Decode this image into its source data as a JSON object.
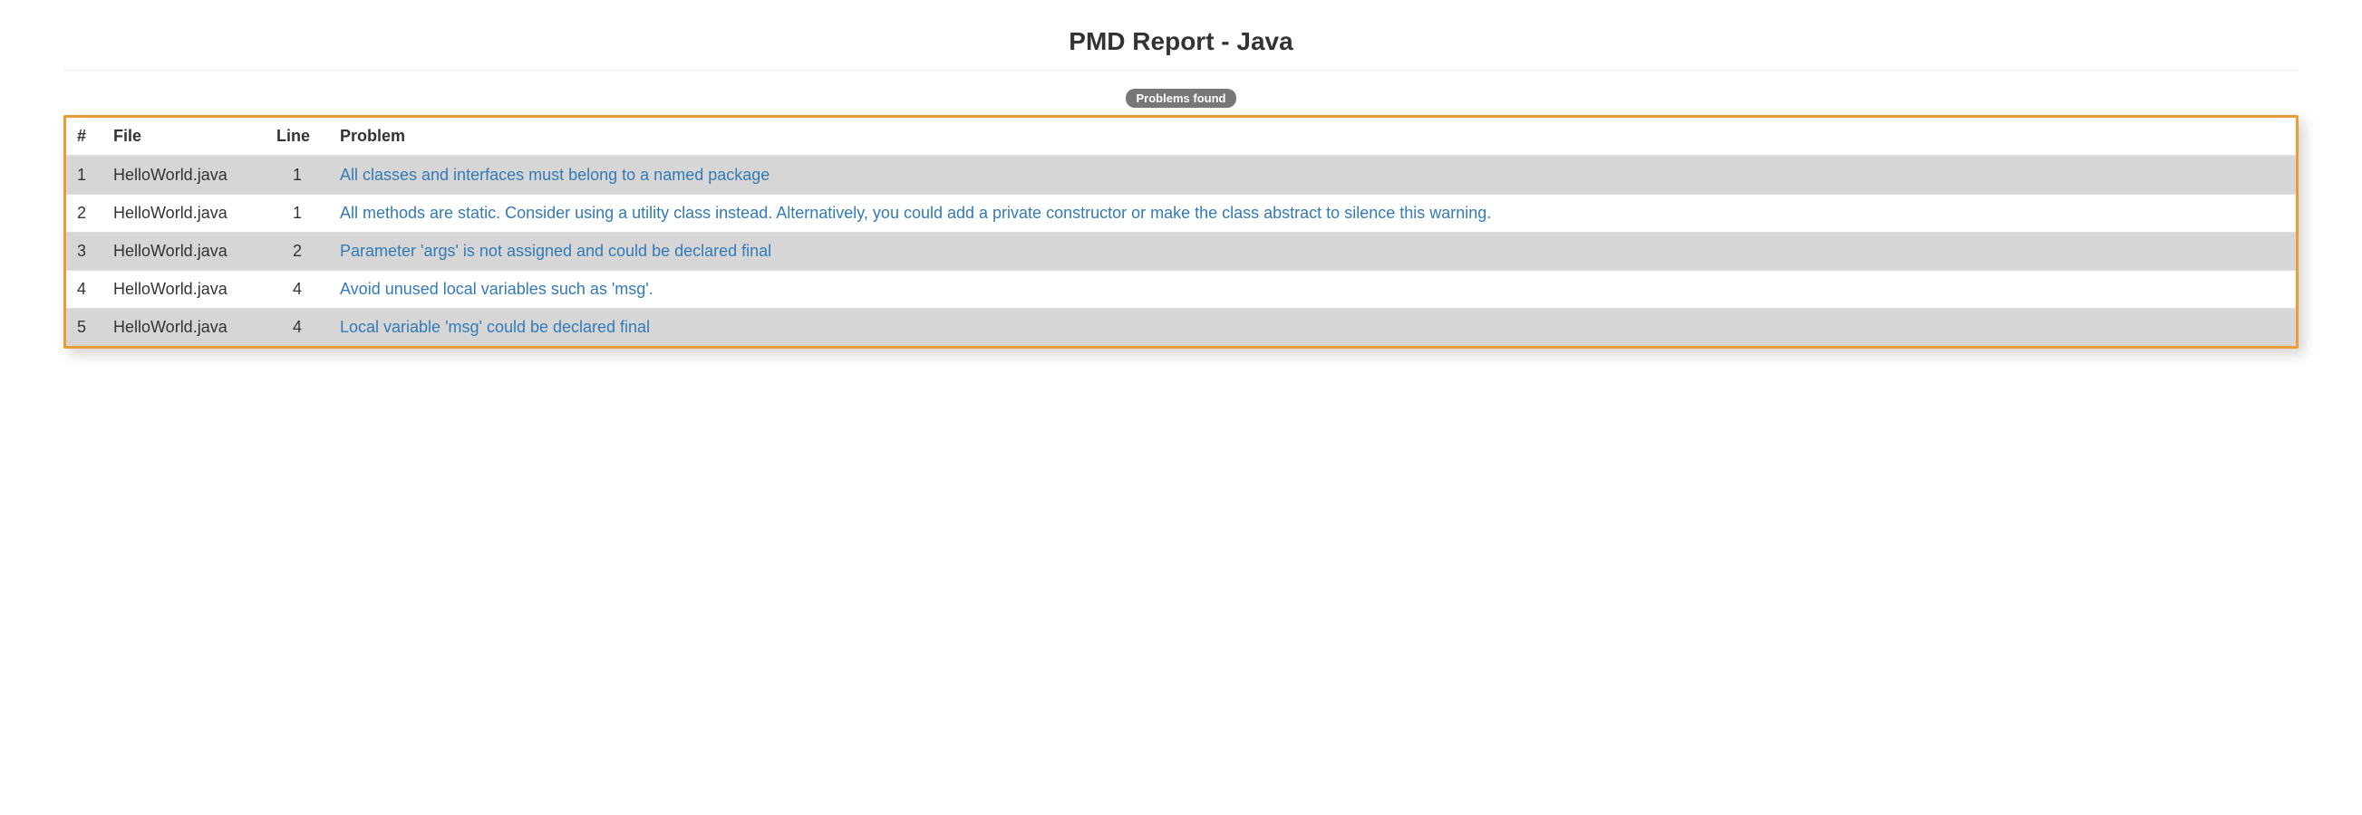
{
  "title": "PMD Report - Java",
  "badge": "Problems found",
  "columns": {
    "num": "#",
    "file": "File",
    "line": "Line",
    "problem": "Problem"
  },
  "rows": [
    {
      "num": "1",
      "file": "HelloWorld.java",
      "line": "1",
      "problem": "All classes and interfaces must belong to a named package"
    },
    {
      "num": "2",
      "file": "HelloWorld.java",
      "line": "1",
      "problem": "All methods are static. Consider using a utility class instead. Alternatively, you could add a private constructor or make the class abstract to silence this warning."
    },
    {
      "num": "3",
      "file": "HelloWorld.java",
      "line": "2",
      "problem": "Parameter 'args' is not assigned and could be declared final"
    },
    {
      "num": "4",
      "file": "HelloWorld.java",
      "line": "4",
      "problem": "Avoid unused local variables such as 'msg'."
    },
    {
      "num": "5",
      "file": "HelloWorld.java",
      "line": "4",
      "problem": "Local variable 'msg' could be declared final"
    }
  ]
}
